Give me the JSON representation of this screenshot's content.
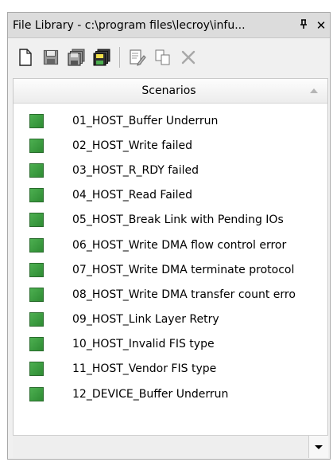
{
  "window": {
    "title": "File Library - c:\\program files\\lecroy\\infu...",
    "pin_glyph": "⨅",
    "close_glyph": "✕"
  },
  "toolbar": {
    "icons": [
      "new-icon",
      "save-icon",
      "save-all-icon",
      "save-colored-icon",
      "edit-icon",
      "copy-icon",
      "delete-icon"
    ]
  },
  "list": {
    "column_header": "Scenarios",
    "status_color": "#3a9d40",
    "items": [
      "01_HOST_Buffer Underrun",
      "02_HOST_Write failed",
      "03_HOST_R_RDY failed",
      "04_HOST_Read Failed",
      "05_HOST_Break Link with Pending IOs",
      "06_HOST_Write DMA flow control error",
      "07_HOST_Write DMA terminate protocol",
      "08_HOST_Write DMA transfer count erro",
      "09_HOST_Link Layer Retry",
      "10_HOST_Invalid FIS type",
      "11_HOST_Vendor FIS type",
      "12_DEVICE_Buffer Underrun"
    ]
  }
}
